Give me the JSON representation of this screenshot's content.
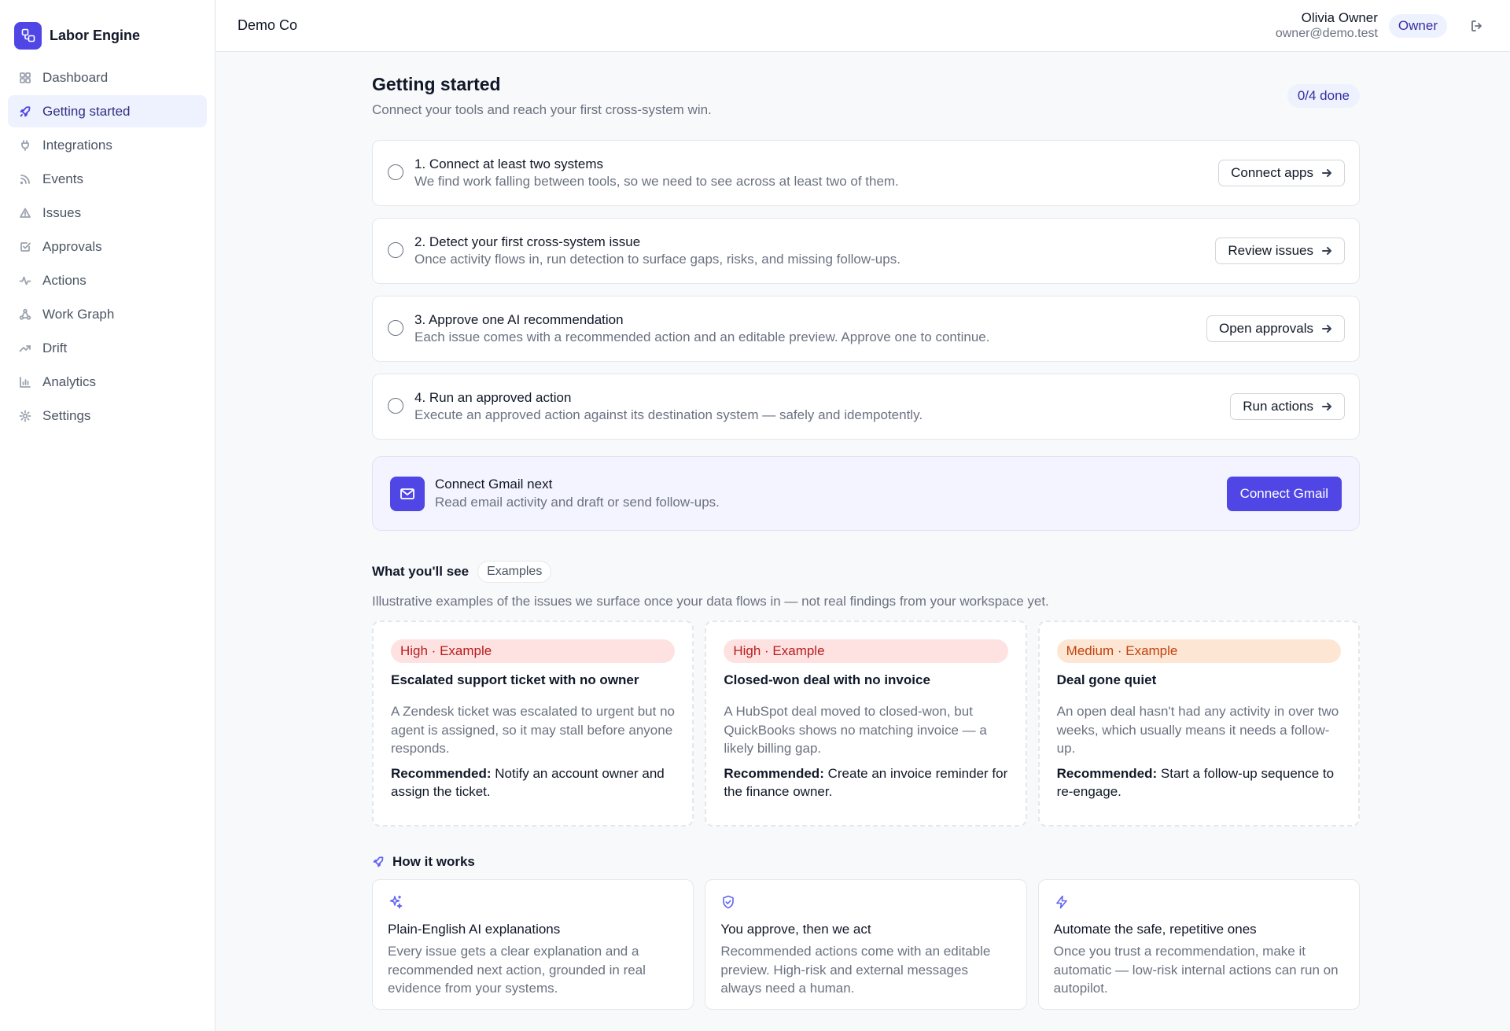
{
  "brand": {
    "name": "Labor Engine",
    "logo_icon": "logo-icon"
  },
  "nav": [
    {
      "label": "Dashboard",
      "icon": "grid-icon"
    },
    {
      "label": "Getting started",
      "icon": "rocket-icon",
      "active": true
    },
    {
      "label": "Integrations",
      "icon": "plug-icon"
    },
    {
      "label": "Events",
      "icon": "rss-icon"
    },
    {
      "label": "Issues",
      "icon": "alert-triangle-icon"
    },
    {
      "label": "Approvals",
      "icon": "check-square-icon"
    },
    {
      "label": "Actions",
      "icon": "activity-icon"
    },
    {
      "label": "Work Graph",
      "icon": "workflow-icon"
    },
    {
      "label": "Drift",
      "icon": "trending-up-icon"
    },
    {
      "label": "Analytics",
      "icon": "bar-chart-icon"
    },
    {
      "label": "Settings",
      "icon": "gear-icon"
    }
  ],
  "header": {
    "org": "Demo Co",
    "user_name": "Olivia Owner",
    "user_email": "owner@demo.test",
    "role": "Owner"
  },
  "page": {
    "title": "Getting started",
    "subtitle": "Connect your tools and reach your first cross-system win.",
    "progress": "0/4 done"
  },
  "steps": [
    {
      "title": "1. Connect at least two systems",
      "desc": "We find work falling between tools, so we need to see across at least two of them.",
      "button": "Connect apps"
    },
    {
      "title": "2. Detect your first cross-system issue",
      "desc": "Once activity flows in, run detection to surface gaps, risks, and missing follow-ups.",
      "button": "Review issues"
    },
    {
      "title": "3. Approve one AI recommendation",
      "desc": "Each issue comes with a recommended action and an editable preview. Approve one to continue.",
      "button": "Open approvals"
    },
    {
      "title": "4. Run an approved action",
      "desc": "Execute an approved action against its destination system — safely and idempotently.",
      "button": "Run actions"
    }
  ],
  "gmail": {
    "title": "Connect Gmail next",
    "desc": "Read email activity and draft or send follow-ups.",
    "button": "Connect Gmail"
  },
  "examples_section": {
    "title": "What you'll see",
    "tag": "Examples",
    "desc": "Illustrative examples of the issues we surface once your data flows in — not real findings from your workspace yet.",
    "cards": [
      {
        "severity": "High · Example",
        "level": "high",
        "title": "Escalated support ticket with no owner",
        "desc": "A Zendesk ticket was escalated to urgent but no agent is assigned, so it may stall before anyone responds.",
        "rec_label": "Recommended:",
        "rec": "Notify an account owner and assign the ticket."
      },
      {
        "severity": "High · Example",
        "level": "high",
        "title": "Closed-won deal with no invoice",
        "desc": "A HubSpot deal moved to closed-won, but QuickBooks shows no matching invoice — a likely billing gap.",
        "rec_label": "Recommended:",
        "rec": "Create an invoice reminder for the finance owner."
      },
      {
        "severity": "Medium · Example",
        "level": "medium",
        "title": "Deal gone quiet",
        "desc": "An open deal hasn't had any activity in over two weeks, which usually means it needs a follow-up.",
        "rec_label": "Recommended:",
        "rec": "Start a follow-up sequence to re-engage."
      }
    ]
  },
  "how_section": {
    "title": "How it works",
    "cards": [
      {
        "icon": "sparkles-icon",
        "title": "Plain-English AI explanations",
        "desc": "Every issue gets a clear explanation and a recommended next action, grounded in real evidence from your systems."
      },
      {
        "icon": "shield-check-icon",
        "title": "You approve, then we act",
        "desc": "Recommended actions come with an editable preview. High-risk and external messages always need a human."
      },
      {
        "icon": "zap-icon",
        "title": "Automate the safe, repetitive ones",
        "desc": "Once you trust a recommendation, make it automatic — low-risk internal actions can run on autopilot."
      }
    ]
  },
  "colors": {
    "accent": "#4f46e5",
    "high": "#b91c1c",
    "medium": "#c2410c"
  }
}
